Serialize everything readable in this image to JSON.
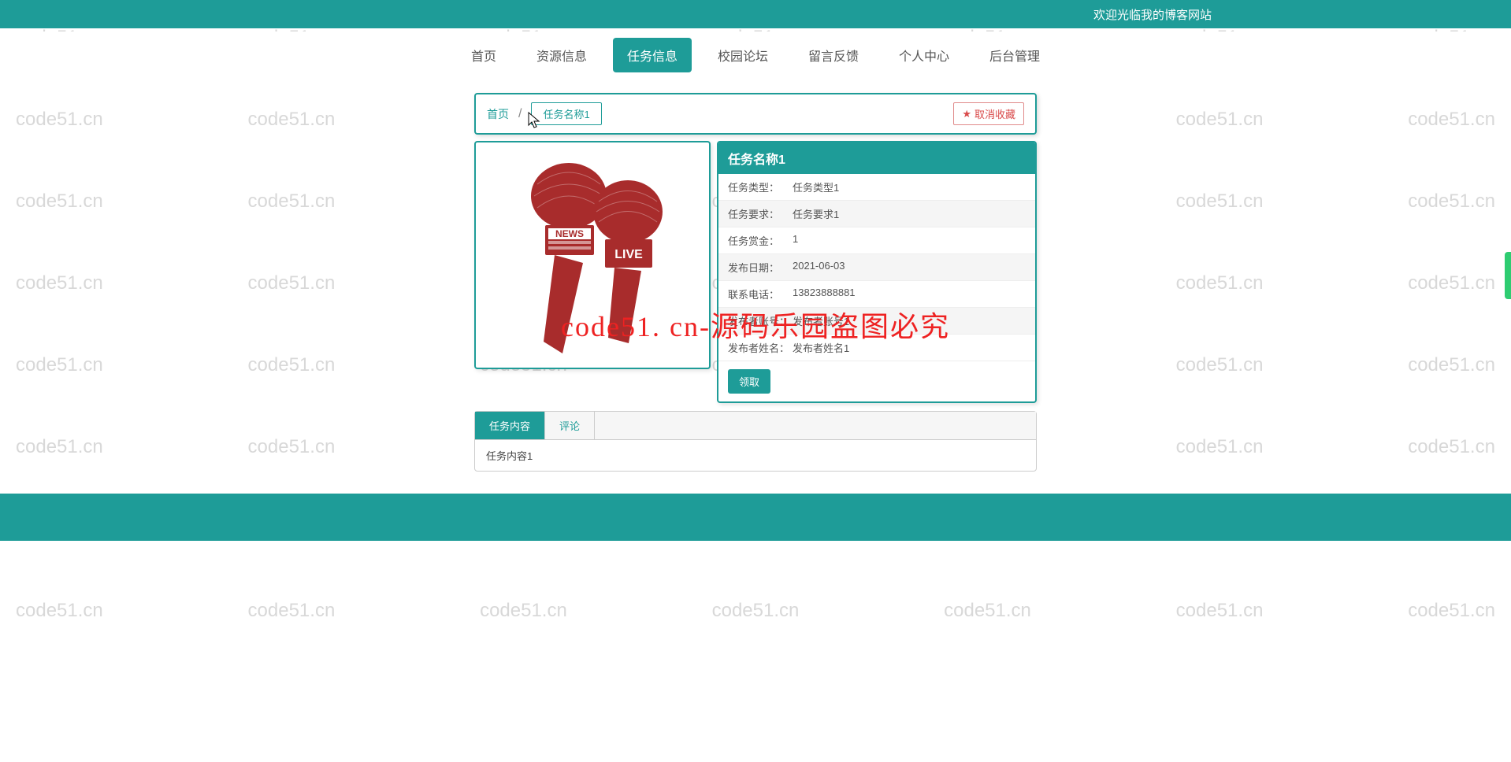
{
  "watermark_text": "code51.cn",
  "red_overlay": "code51. cn-源码乐园盗图必究",
  "banner": {
    "welcome": "欢迎光临我的博客网站"
  },
  "nav": {
    "items": [
      {
        "label": "首页"
      },
      {
        "label": "资源信息"
      },
      {
        "label": "任务信息",
        "active": true
      },
      {
        "label": "校园论坛"
      },
      {
        "label": "留言反馈"
      },
      {
        "label": "个人中心"
      },
      {
        "label": "后台管理"
      }
    ]
  },
  "breadcrumb": {
    "home": "首页",
    "current": "任务名称1",
    "fav_label": "取消收藏"
  },
  "task": {
    "title": "任务名称1",
    "rows": [
      {
        "label": "任务类型：",
        "value": "任务类型1"
      },
      {
        "label": "任务要求：",
        "value": "任务要求1"
      },
      {
        "label": "任务赏金：",
        "value": "1"
      },
      {
        "label": "发布日期：",
        "value": "2021-06-03"
      },
      {
        "label": "联系电话：",
        "value": "13823888881"
      },
      {
        "label": "发布者账号：",
        "value": "发布者账号1"
      },
      {
        "label": "发布者姓名：",
        "value": "发布者姓名1"
      }
    ],
    "accept_label": "领取"
  },
  "tabs": {
    "items": [
      {
        "label": "任务内容",
        "active": true
      },
      {
        "label": "评论"
      }
    ],
    "content": "任务内容1"
  }
}
